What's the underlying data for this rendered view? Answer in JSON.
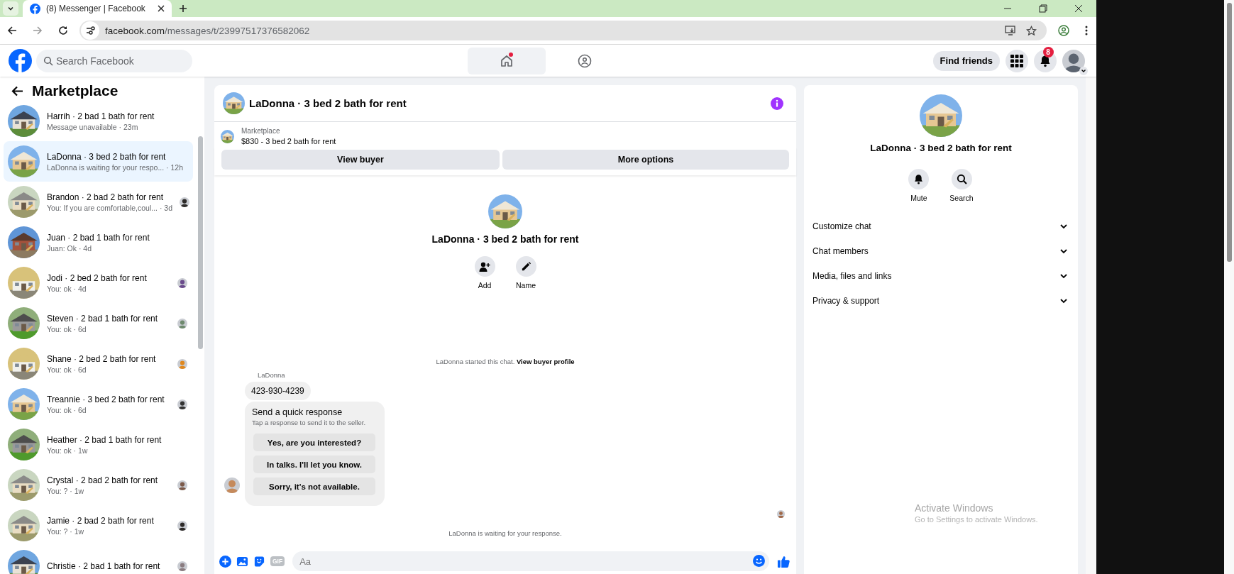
{
  "browser": {
    "tab_title": "(8) Messenger | Facebook",
    "url_host": "facebook.com",
    "url_path": "/messages/t/23997517376582062"
  },
  "header": {
    "search_placeholder": "Search Facebook",
    "nav": [
      {
        "kind": "home",
        "selected": true,
        "unread": true
      },
      {
        "kind": "groups",
        "selected": false,
        "unread": false
      }
    ],
    "find_friends": "Find friends",
    "notification_count": "8"
  },
  "sidebar": {
    "title": "Marketplace",
    "conversations": [
      {
        "title": "Harrih · 2 bad 1 bath for rent",
        "snippet": "Message unavailable · 23m",
        "selected": false,
        "seen_avatar": false
      },
      {
        "title": "LaDonna · 3 bed 2 bath for rent",
        "snippet": "LaDonna is waiting for your respo... · 12h",
        "selected": true,
        "seen_avatar": false
      },
      {
        "title": "Brandon · 2 bad 2 bath for rent",
        "snippet": "You: If you are comfortable,coul... · 3d",
        "selected": false,
        "seen_avatar": true
      },
      {
        "title": "Juan · 2 bad 1 bath for rent",
        "snippet": "Juan: Ok · 4d",
        "selected": false,
        "seen_avatar": false
      },
      {
        "title": "Jodi · 2 bed 2 bath for rent",
        "snippet": "You: ok · 4d",
        "selected": false,
        "seen_avatar": true
      },
      {
        "title": "Steven · 2 bad 1 bath for rent",
        "snippet": "You: ok · 6d",
        "selected": false,
        "seen_avatar": true
      },
      {
        "title": "Shane · 2 bed 2 bath for rent",
        "snippet": "You: ok · 6d",
        "selected": false,
        "seen_avatar": true
      },
      {
        "title": "Treannie · 3 bed 2 bath for rent",
        "snippet": "You: ok · 6d",
        "selected": false,
        "seen_avatar": true
      },
      {
        "title": "Heather · 2 bad 1 bath for rent",
        "snippet": "You: ok · 1w",
        "selected": false,
        "seen_avatar": false
      },
      {
        "title": "Crystal · 2 bad 2 bath for rent",
        "snippet": "You: ? · 1w",
        "selected": false,
        "seen_avatar": true
      },
      {
        "title": "Jamie · 2 bad 2 bath for rent",
        "snippet": "You: ? · 1w",
        "selected": false,
        "seen_avatar": true
      },
      {
        "title": "Christie · 2 bad 1 bath for rent",
        "selected": false,
        "seen_avatar": true
      }
    ]
  },
  "chat": {
    "title": "LaDonna · 3 bed 2 bath for rent",
    "listing": {
      "label": "Marketplace",
      "price_title": "$830 - 3 bed 2 bath for rent"
    },
    "buttons": [
      "View buyer",
      "More options"
    ],
    "profile": {
      "name": "LaDonna · 3 bed 2 bath for rent",
      "actions": [
        {
          "kind": "add",
          "label": "Add"
        },
        {
          "kind": "name",
          "label": "Name"
        }
      ]
    },
    "system_note": {
      "text": "LaDonna started this chat.",
      "link": "View buyer profile"
    },
    "message": {
      "sender": "LaDonna",
      "text": "423-930-4239"
    },
    "quick_response": {
      "title": "Send a quick response",
      "subtitle": "Tap a response to send it to the seller.",
      "options": [
        "Yes, are you interested?",
        "In talks. I'll let you know.",
        "Sorry, it's not available."
      ]
    },
    "status": "LaDonna is waiting for your response.",
    "composer": {
      "gif_label": "GIF",
      "placeholder": "Aa"
    }
  },
  "details": {
    "name": "LaDonna · 3 bed 2 bath for rent",
    "actions": [
      {
        "kind": "mute",
        "label": "Mute"
      },
      {
        "kind": "search",
        "label": "Search"
      }
    ],
    "sections": [
      {
        "label": "Customize chat",
        "expanded": false
      },
      {
        "label": "Chat members",
        "expanded": false
      },
      {
        "label": "Media, files and links",
        "expanded": false
      },
      {
        "label": "Privacy & support",
        "expanded": false
      }
    ]
  },
  "os_notice": {
    "title": "Activate Windows",
    "subtitle": "Go to Settings to activate Windows."
  }
}
